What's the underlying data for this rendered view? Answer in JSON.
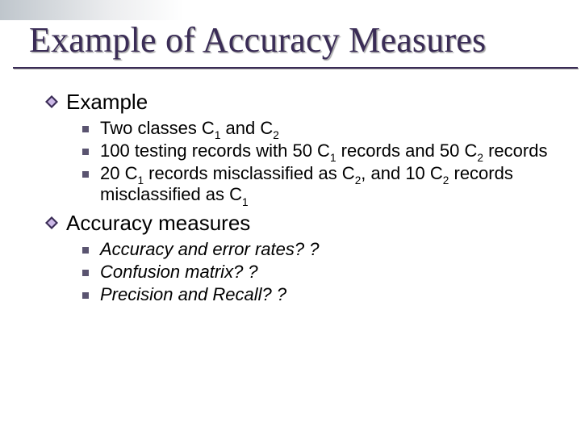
{
  "title": "Example of Accuracy Measures",
  "sections": [
    {
      "label": "Example",
      "items": [
        {
          "parts": [
            "Two classes C",
            "1",
            " and C",
            "2"
          ],
          "italic": false
        },
        {
          "parts": [
            "100 testing records with 50 C",
            "1",
            " records and 50 C",
            "2",
            " records"
          ],
          "italic": false
        },
        {
          "parts": [
            "20 C",
            "1",
            " records misclassified as C",
            "2",
            ", and 10 C",
            "2",
            " records misclassified as C",
            "1"
          ],
          "italic": false
        }
      ]
    },
    {
      "label": "Accuracy measures",
      "items": [
        {
          "parts": [
            "Accuracy and error rates? ?"
          ],
          "italic": true
        },
        {
          "parts": [
            "Confusion matrix? ?"
          ],
          "italic": true
        },
        {
          "parts": [
            "Precision and Recall? ?"
          ],
          "italic": true
        }
      ]
    }
  ],
  "colors": {
    "accent": "#3a2c56",
    "bullet2": "#5a5470"
  }
}
